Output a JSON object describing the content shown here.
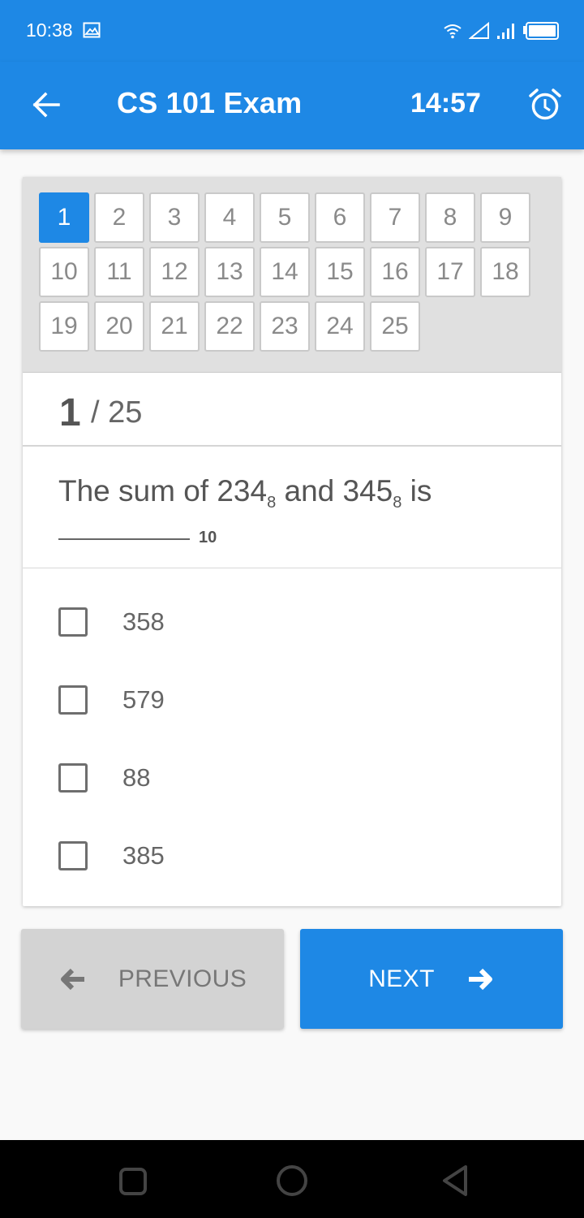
{
  "status_bar": {
    "time": "10:38",
    "icons": [
      "image-icon",
      "wifi-icon",
      "signal-outline-icon",
      "signal-bars-icon",
      "battery-icon"
    ]
  },
  "app_bar": {
    "title": "CS 101 Exam",
    "timer": "14:57",
    "icons": [
      "arrow-back-icon",
      "alarm-clock-icon"
    ]
  },
  "question_grid": {
    "selected": "1",
    "numbers": [
      "1",
      "2",
      "3",
      "4",
      "5",
      "6",
      "7",
      "8",
      "9",
      "10",
      "11",
      "12",
      "13",
      "14",
      "15",
      "16",
      "17",
      "18",
      "19",
      "20",
      "21",
      "22",
      "23",
      "24",
      "25"
    ]
  },
  "counter": {
    "current": "1",
    "separator_total": "/ 25"
  },
  "question": {
    "prefix": "The sum of 234",
    "sub1": "8",
    "middle": " and 345",
    "sub2": "8",
    "suffix": " is",
    "blank_base": "10"
  },
  "options": [
    {
      "label": "358",
      "checked": false
    },
    {
      "label": "579",
      "checked": false
    },
    {
      "label": "88",
      "checked": false
    },
    {
      "label": "385",
      "checked": false
    }
  ],
  "buttons": {
    "previous": "PREVIOUS",
    "next": "NEXT"
  },
  "colors": {
    "primary": "#1e88e5",
    "grid_background": "#e0e0e0",
    "disabled_button": "#d3d3d3"
  }
}
